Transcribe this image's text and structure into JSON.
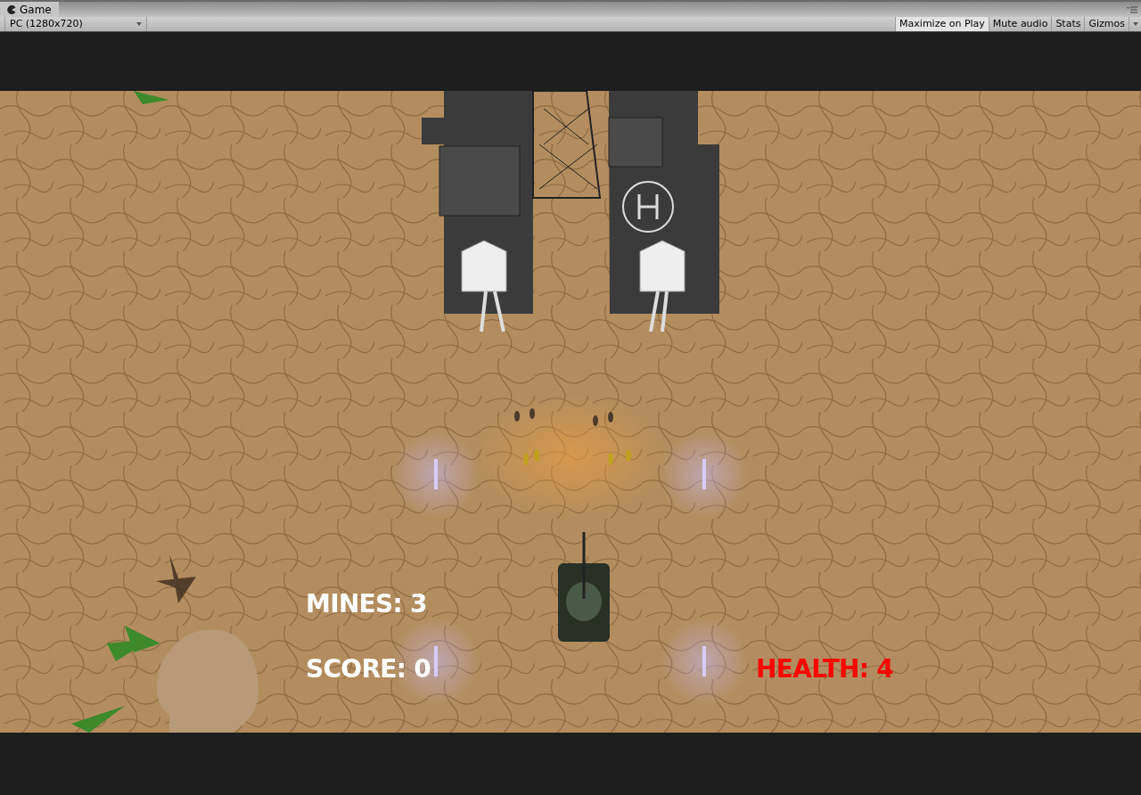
{
  "window": {
    "tab_title": "Game"
  },
  "toolbar": {
    "resolution": "PC (1280x720)",
    "toggles": [
      {
        "label": "Maximize on Play",
        "selected": true
      },
      {
        "label": "Mute audio",
        "selected": false
      },
      {
        "label": "Stats",
        "selected": false
      },
      {
        "label": "Gizmos",
        "selected": false
      }
    ]
  },
  "hud": {
    "mines": "MINES: 3",
    "score": "SCORE: 0",
    "health": "HEALTH: 4"
  }
}
